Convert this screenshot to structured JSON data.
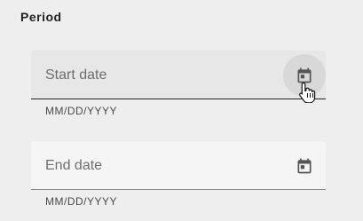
{
  "section": {
    "title": "Period"
  },
  "start_date": {
    "label": "Start date",
    "hint": "MM/DD/YYYY",
    "icon": "calendar-icon"
  },
  "end_date": {
    "label": "End date",
    "hint": "MM/DD/YYYY",
    "icon": "calendar-icon"
  },
  "colors": {
    "background": "#eeeeee",
    "field_active": "#e7e7e7",
    "field_idle": "#f5f5f5",
    "icon": "#555555"
  }
}
